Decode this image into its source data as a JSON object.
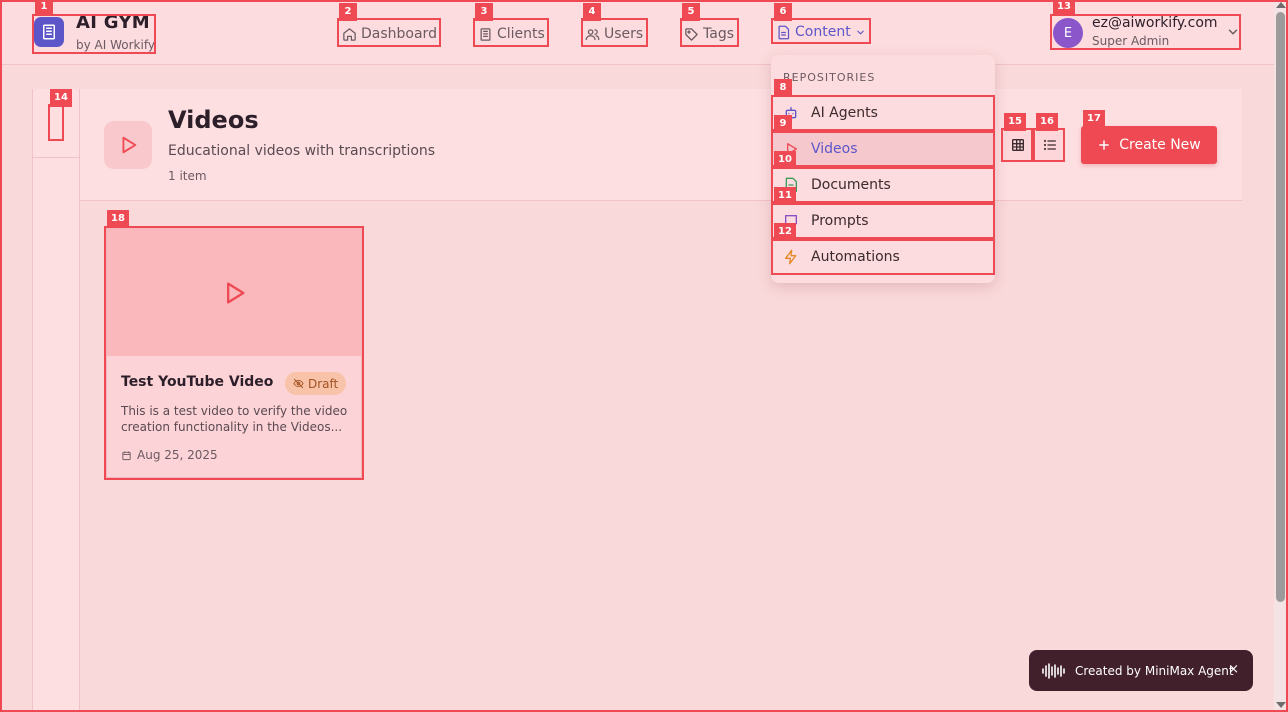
{
  "brand": {
    "title": "AI GYM",
    "subtitle": "by AI Workify",
    "logo_icon": "building-icon"
  },
  "nav": {
    "items": [
      {
        "label": "Dashboard",
        "icon": "home-icon"
      },
      {
        "label": "Clients",
        "icon": "building-icon"
      },
      {
        "label": "Users",
        "icon": "users-icon"
      },
      {
        "label": "Tags",
        "icon": "tag-icon"
      },
      {
        "label": "Content",
        "icon": "document-icon"
      }
    ]
  },
  "user": {
    "initial": "E",
    "email": "ez@aiworkify.com",
    "role": "Super Admin"
  },
  "content_menu": {
    "section_label": "REPOSITORIES",
    "items": [
      {
        "label": "AI Agents",
        "icon": "bot-icon"
      },
      {
        "label": "Videos",
        "icon": "play-icon"
      },
      {
        "label": "Documents",
        "icon": "file-icon"
      },
      {
        "label": "Prompts",
        "icon": "message-icon"
      },
      {
        "label": "Automations",
        "icon": "zap-icon"
      }
    ]
  },
  "page": {
    "title": "Videos",
    "description": "Educational videos with transcriptions",
    "count": "1 item"
  },
  "toolbar": {
    "create_label": "Create New"
  },
  "videos": [
    {
      "title": "Test YouTube Video",
      "status": "Draft",
      "description": "This is a test video to verify the video creation functionality in the Videos...",
      "date": "Aug 25, 2025"
    }
  ],
  "toast": {
    "text": "Created by MiniMax Agent",
    "close": "×"
  },
  "som_labels": [
    "1",
    "2",
    "3",
    "4",
    "5",
    "6",
    "8",
    "9",
    "10",
    "11",
    "12",
    "13",
    "14",
    "15",
    "16",
    "17",
    "18"
  ],
  "colors": {
    "accent": "#ef4a53",
    "brand": "#5d56c8",
    "toast_bg": "#41202b"
  }
}
